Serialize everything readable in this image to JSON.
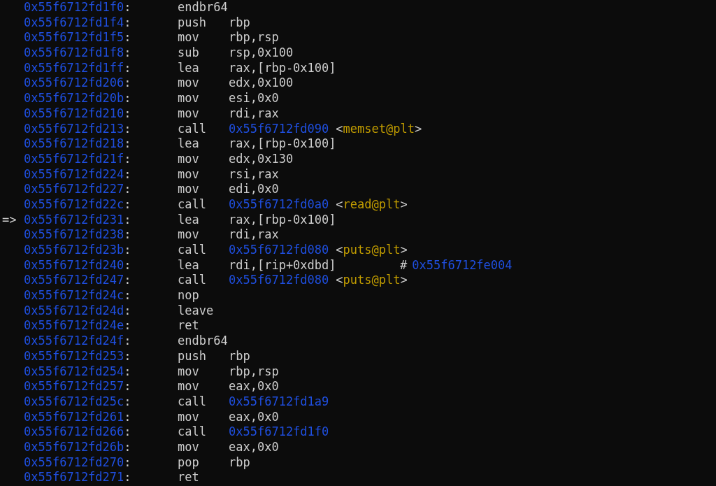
{
  "listing": [
    {
      "address": "0x55f6712fd1f0:",
      "mnemonic": "endbr64"
    },
    {
      "address": "0x55f6712fd1f4:",
      "mnemonic": "push",
      "operands": "rbp"
    },
    {
      "address": "0x55f6712fd1f5:",
      "mnemonic": "mov",
      "operands": "rbp,rsp"
    },
    {
      "address": "0x55f6712fd1f8:",
      "mnemonic": "sub",
      "operands": "rsp,0x100"
    },
    {
      "address": "0x55f6712fd1ff:",
      "mnemonic": "lea",
      "operands": "rax,[rbp-0x100]"
    },
    {
      "address": "0x55f6712fd206:",
      "mnemonic": "mov",
      "operands": "edx,0x100"
    },
    {
      "address": "0x55f6712fd20b:",
      "mnemonic": "mov",
      "operands": "esi,0x0"
    },
    {
      "address": "0x55f6712fd210:",
      "mnemonic": "mov",
      "operands": "rdi,rax"
    },
    {
      "address": "0x55f6712fd213:",
      "mnemonic": "call",
      "target": "0x55f6712fd090",
      "symbol": "<memset@plt>"
    },
    {
      "address": "0x55f6712fd218:",
      "mnemonic": "lea",
      "operands": "rax,[rbp-0x100]"
    },
    {
      "address": "0x55f6712fd21f:",
      "mnemonic": "mov",
      "operands": "edx,0x130"
    },
    {
      "address": "0x55f6712fd224:",
      "mnemonic": "mov",
      "operands": "rsi,rax"
    },
    {
      "address": "0x55f6712fd227:",
      "mnemonic": "mov",
      "operands": "edi,0x0"
    },
    {
      "address": "0x55f6712fd22c:",
      "mnemonic": "call",
      "target": "0x55f6712fd0a0",
      "symbol": "<read@plt>"
    },
    {
      "marker": "=>",
      "address": "0x55f6712fd231:",
      "mnemonic": "lea",
      "operands": "rax,[rbp-0x100]"
    },
    {
      "address": "0x55f6712fd238:",
      "mnemonic": "mov",
      "operands": "rdi,rax"
    },
    {
      "address": "0x55f6712fd23b:",
      "mnemonic": "call",
      "target": "0x55f6712fd080",
      "symbol": "<puts@plt>"
    },
    {
      "address": "0x55f6712fd240:",
      "mnemonic": "lea",
      "operands": "rdi,[rip+0xdbd]",
      "comment_mark": "#",
      "comment_address": "0x55f6712fe004"
    },
    {
      "address": "0x55f6712fd247:",
      "mnemonic": "call",
      "target": "0x55f6712fd080",
      "symbol": "<puts@plt>"
    },
    {
      "address": "0x55f6712fd24c:",
      "mnemonic": "nop"
    },
    {
      "address": "0x55f6712fd24d:",
      "mnemonic": "leave"
    },
    {
      "address": "0x55f6712fd24e:",
      "mnemonic": "ret"
    },
    {
      "address": "0x55f6712fd24f:",
      "mnemonic": "endbr64"
    },
    {
      "address": "0x55f6712fd253:",
      "mnemonic": "push",
      "operands": "rbp"
    },
    {
      "address": "0x55f6712fd254:",
      "mnemonic": "mov",
      "operands": "rbp,rsp"
    },
    {
      "address": "0x55f6712fd257:",
      "mnemonic": "mov",
      "operands": "eax,0x0"
    },
    {
      "address": "0x55f6712fd25c:",
      "mnemonic": "call",
      "target": "0x55f6712fd1a9"
    },
    {
      "address": "0x55f6712fd261:",
      "mnemonic": "mov",
      "operands": "eax,0x0"
    },
    {
      "address": "0x55f6712fd266:",
      "mnemonic": "call",
      "target": "0x55f6712fd1f0"
    },
    {
      "address": "0x55f6712fd26b:",
      "mnemonic": "mov",
      "operands": "eax,0x0"
    },
    {
      "address": "0x55f6712fd270:",
      "mnemonic": "pop",
      "operands": "rbp"
    },
    {
      "address": "0x55f6712fd271:",
      "mnemonic": "ret"
    }
  ]
}
